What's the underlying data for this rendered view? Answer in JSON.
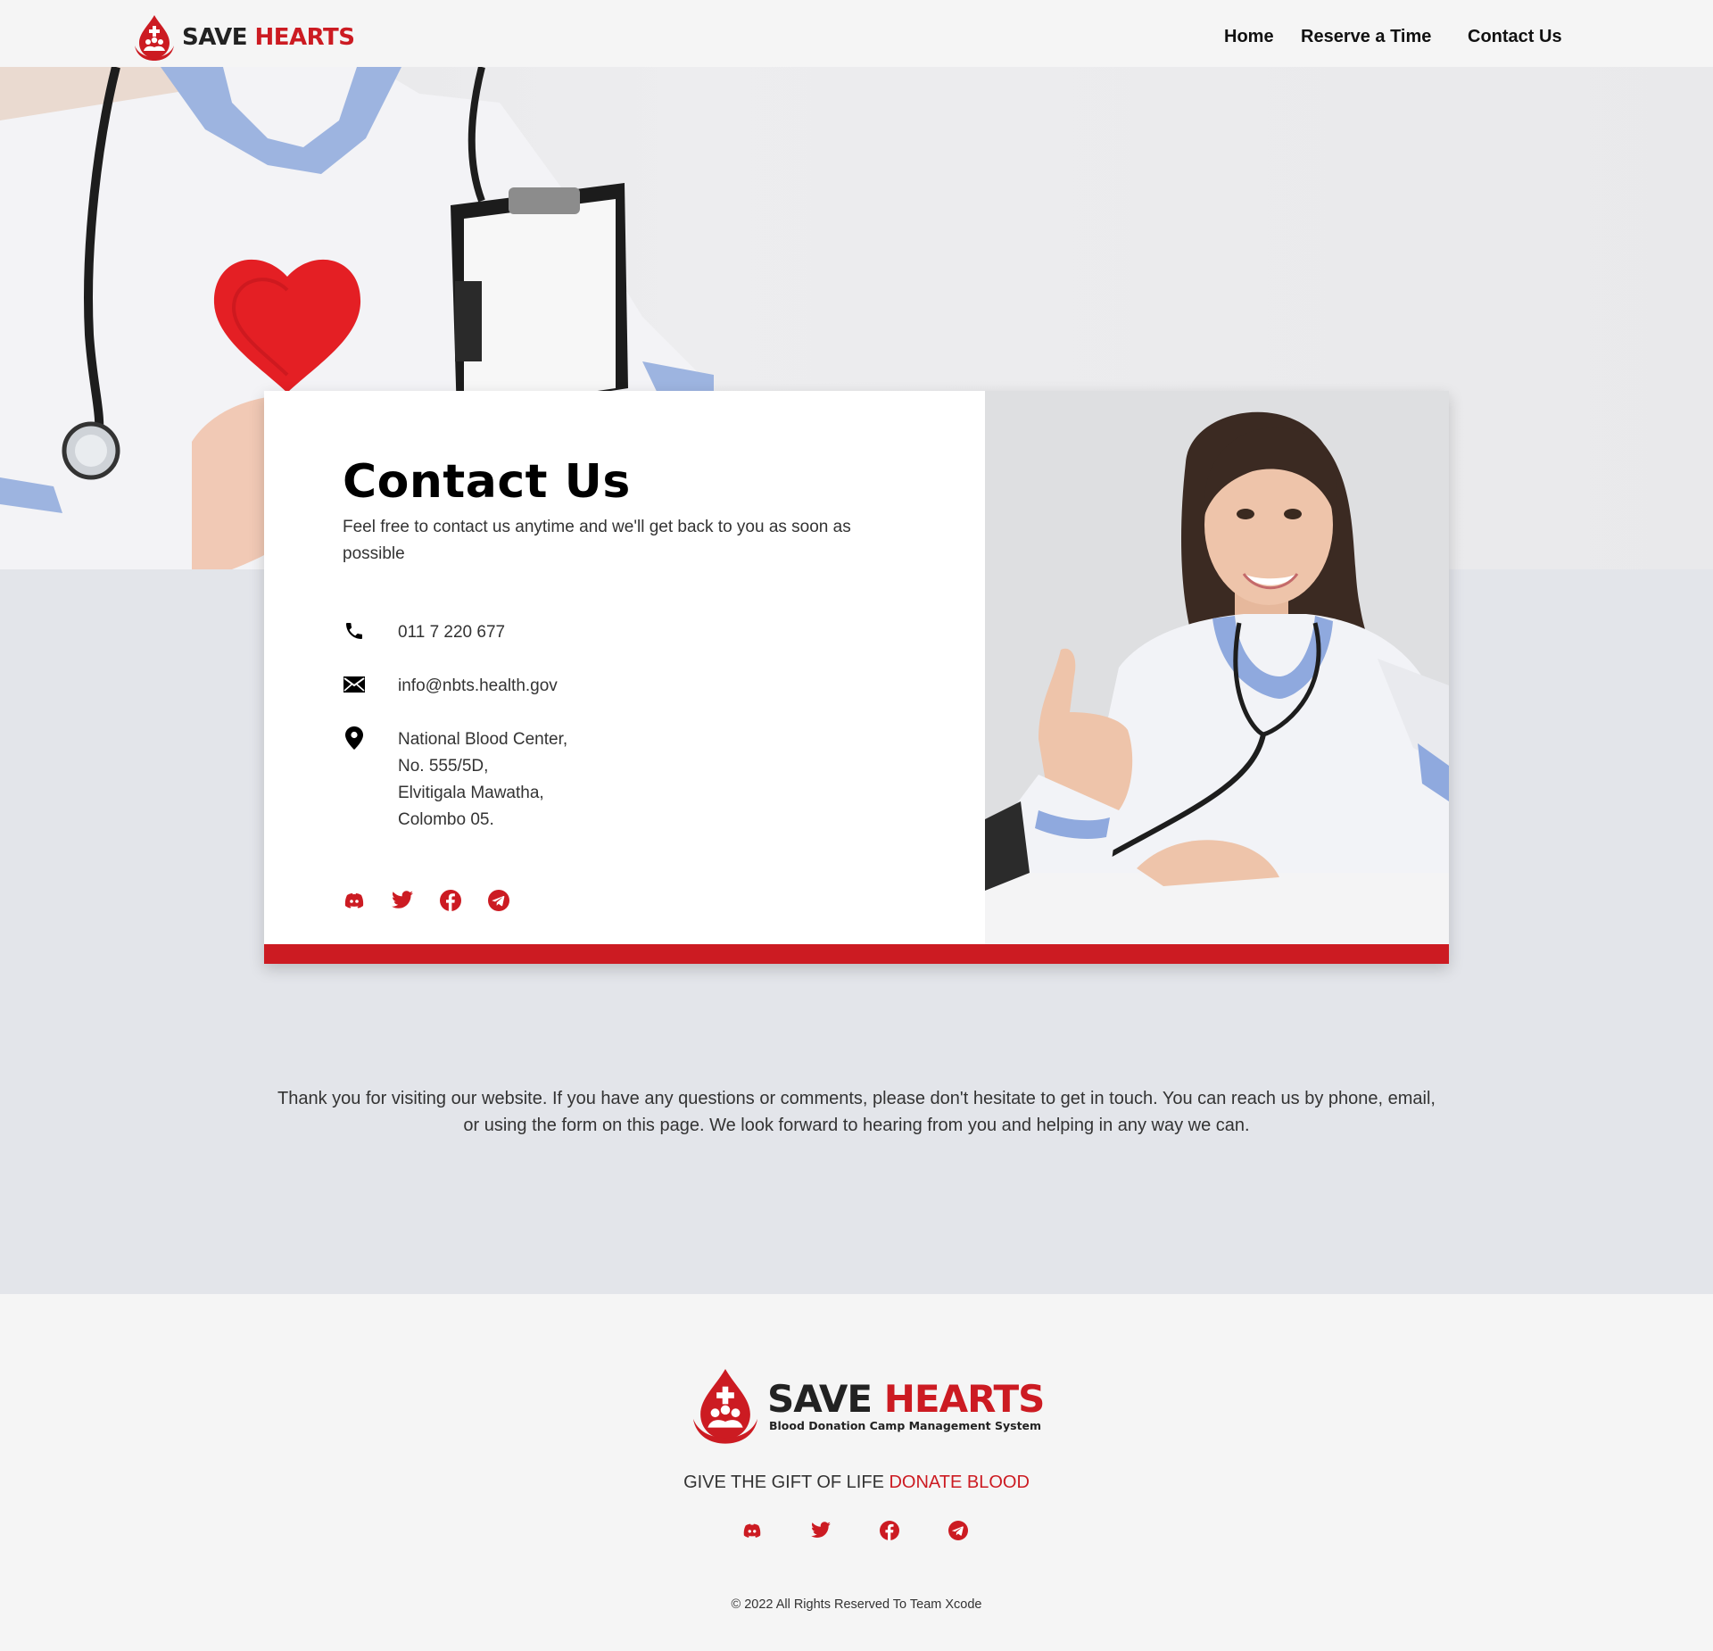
{
  "brand": {
    "name_part1": "SAVE ",
    "name_part2": "HEARTS",
    "subtitle": "Blood Donation Camp Management System"
  },
  "nav": {
    "home": "Home",
    "reserve": "Reserve a Time",
    "contact": "Contact Us"
  },
  "contact": {
    "title": "Contact Us",
    "subtitle": "Feel free to contact us anytime and we'll get back to you as soon as possible",
    "phone": "011 7 220 677",
    "email": "info@nbts.health.gov",
    "address": [
      "National Blood Center,",
      "No. 555/5D,",
      "Elvitigala Mawatha,",
      "Colombo 05."
    ]
  },
  "socials": [
    "discord-icon",
    "twitter-icon",
    "facebook-icon",
    "telegram-icon"
  ],
  "thanks": "Thank you for visiting our website. If you have any questions or comments, please don't hesitate to get in touch. You can reach us by phone, email, or using the form on this page. We look forward to hearing from you and helping in any way we can.",
  "footer": {
    "tagline_part1": "GIVE THE GIFT OF LIFE ",
    "tagline_part2": "DONATE BLOOD",
    "copyright": "© 2022 All Rights Reserved To Team Xcode"
  },
  "colors": {
    "accent": "#cc1b22",
    "background": "#e3e5ea",
    "navbar": "#f5f5f5"
  }
}
